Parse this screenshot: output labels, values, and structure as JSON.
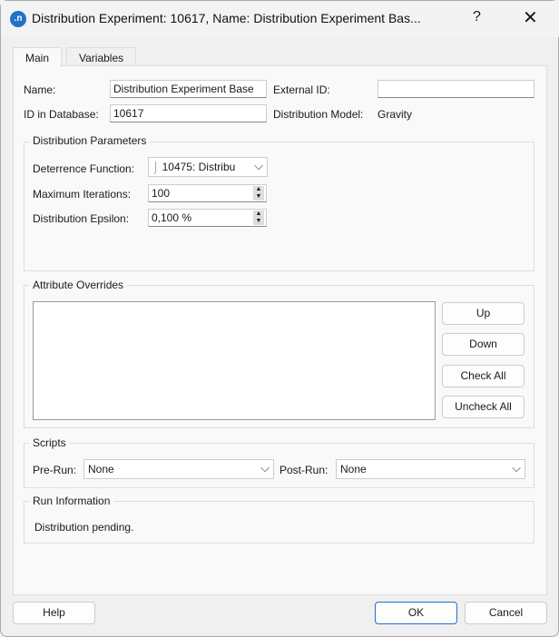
{
  "title": "Distribution Experiment: 10617, Name: Distribution Experiment Bas...",
  "app_icon": ".n",
  "title_help": "?",
  "title_close": "✕",
  "tabs": [
    "Main",
    "Variables"
  ],
  "main": {
    "name_label": "Name:",
    "name_value": "Distribution Experiment Base",
    "external_id_label": "External ID:",
    "external_id_value": "",
    "id_label": "ID in Database:",
    "id_value": "10617",
    "model_label": "Distribution Model:",
    "model_value": "Gravity"
  },
  "params": {
    "title": "Distribution Parameters",
    "deterrence_label": "Deterrence Function:",
    "deterrence_value": "10475: Distribu",
    "max_iter_label": "Maximum Iterations:",
    "max_iter_value": "100",
    "epsilon_label": "Distribution Epsilon:",
    "epsilon_value": "0,100 %"
  },
  "overrides": {
    "title": "Attribute Overrides",
    "buttons": [
      "Up",
      "Down",
      "Check All",
      "Uncheck All"
    ]
  },
  "scripts": {
    "title": "Scripts",
    "pre_label": "Pre-Run:",
    "pre_value": "None",
    "post_label": "Post-Run:",
    "post_value": "None"
  },
  "run": {
    "title": "Run Information",
    "text": "Distribution pending."
  },
  "footer": {
    "help": "Help",
    "ok": "OK",
    "cancel": "Cancel"
  }
}
